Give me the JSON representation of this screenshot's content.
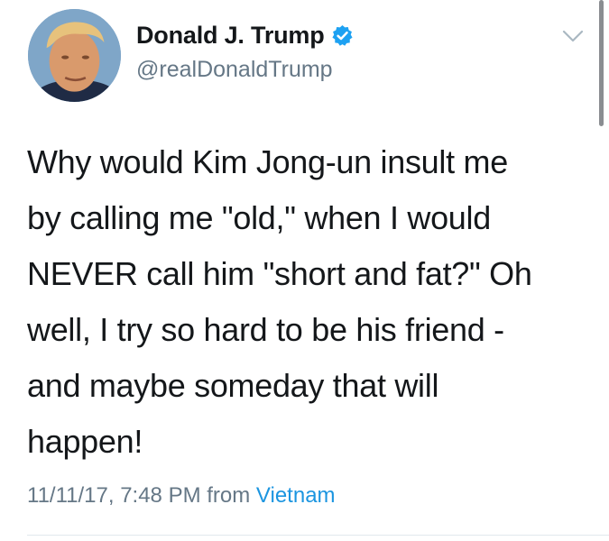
{
  "author": {
    "display_name": "Donald J. Trump",
    "handle": "@realDonaldTrump",
    "verified": true,
    "verified_color": "#1da1f2"
  },
  "icons": {
    "verified": "verified-badge-icon",
    "menu": "chevron-down-icon"
  },
  "tweet": {
    "text_lines": [
      "Why would Kim Jong-un insult me",
      "by calling me \"old,\" when I would",
      "NEVER call him \"short and fat?\" Oh",
      "well, I try so hard to be his friend -",
      "and maybe someday that will",
      "happen!"
    ]
  },
  "meta": {
    "timestamp": "11/11/17, 7:48 PM",
    "from_label": "from",
    "source": "Vietnam",
    "link_color": "#1b95e0"
  }
}
